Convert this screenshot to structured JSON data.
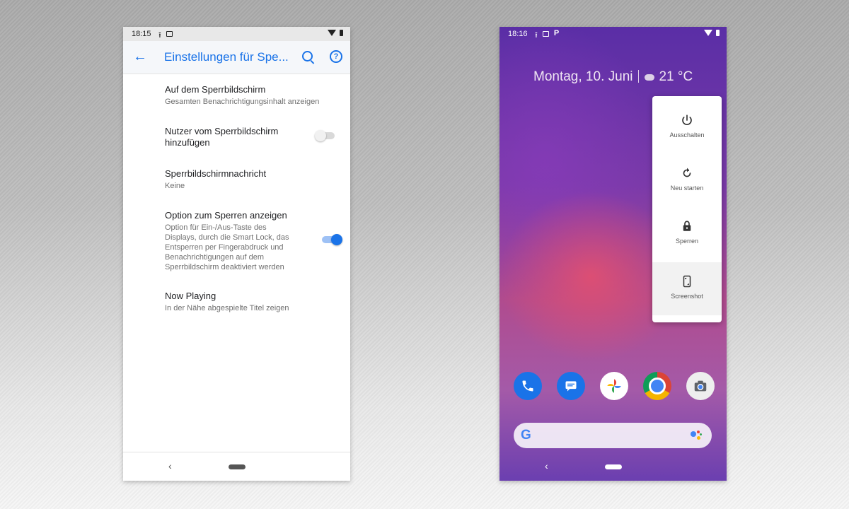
{
  "left_phone": {
    "status": {
      "time": "18:15"
    },
    "app_bar": {
      "title": "Einstellungen für Spe..."
    },
    "settings": [
      {
        "title": "Auf dem Sperrbildschirm",
        "subtitle": "Gesamten Benachrichtigungsinhalt anzeigen"
      },
      {
        "title": "Nutzer vom Sperrbildschirm hinzufügen",
        "toggle": "off"
      },
      {
        "title": "Sperrbildschirmnachricht",
        "subtitle": "Keine"
      },
      {
        "title": "Option zum Sperren anzeigen",
        "subtitle": "Option für Ein-/Aus-Taste des Displays, durch die Smart Lock, das Entsperren per Fingerabdruck und Benachrichtigungen auf dem Sperrbildschirm deaktiviert werden",
        "toggle": "on"
      },
      {
        "title": "Now Playing",
        "subtitle": "In der Nähe abgespielte Titel zeigen"
      }
    ],
    "accent_color": "#1a73e8"
  },
  "right_phone": {
    "status": {
      "time": "18:16"
    },
    "date": "Montag, 10. Juni",
    "temperature": "21 °C",
    "power_menu": [
      {
        "icon": "power-icon",
        "label": "Ausschalten"
      },
      {
        "icon": "restart-icon",
        "label": "Neu starten"
      },
      {
        "icon": "lock-icon",
        "label": "Sperren"
      },
      {
        "icon": "screenshot-icon",
        "label": "Screenshot"
      }
    ],
    "dock_apps": [
      "phone-app-icon",
      "messages-app-icon",
      "photos-app-icon",
      "chrome-app-icon",
      "camera-app-icon"
    ],
    "search_logo": "G"
  }
}
